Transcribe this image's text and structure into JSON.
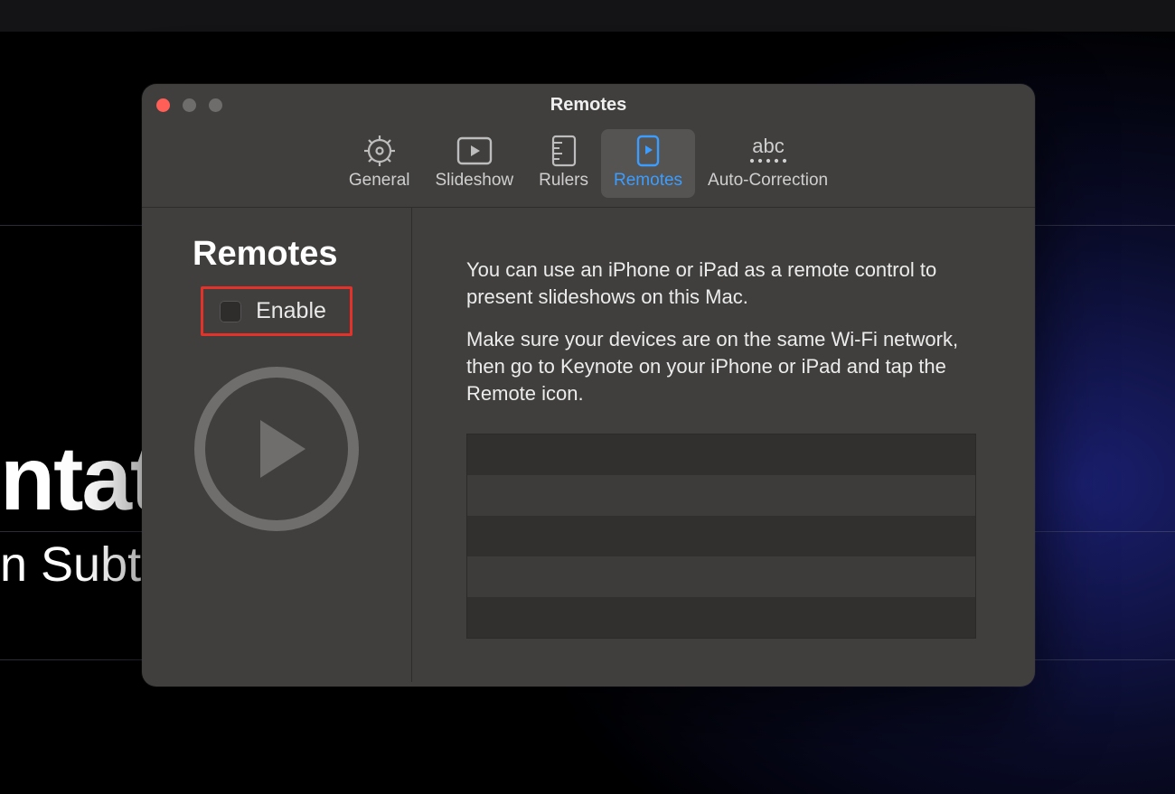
{
  "background": {
    "title_fragment": "ntat",
    "subtitle_fragment": "n Subti"
  },
  "window": {
    "title": "Remotes",
    "tabs": [
      {
        "id": "general",
        "label": "General"
      },
      {
        "id": "slideshow",
        "label": "Slideshow"
      },
      {
        "id": "rulers",
        "label": "Rulers"
      },
      {
        "id": "remotes",
        "label": "Remotes"
      },
      {
        "id": "autocorrection",
        "label": "Auto-Correction"
      }
    ],
    "active_tab": "remotes",
    "sidebar": {
      "heading": "Remotes",
      "enable_label": "Enable",
      "enable_checked": false
    },
    "description": {
      "p1": "You can use an iPhone or iPad as a remote control to present slideshows on this Mac.",
      "p2": "Make sure your devices are on the same Wi-Fi network, then go to Keynote on your iPhone or iPad and tap the Remote icon."
    },
    "device_rows": 5,
    "colors": {
      "highlight_border": "#e4322b",
      "accent": "#3b9dff"
    }
  }
}
